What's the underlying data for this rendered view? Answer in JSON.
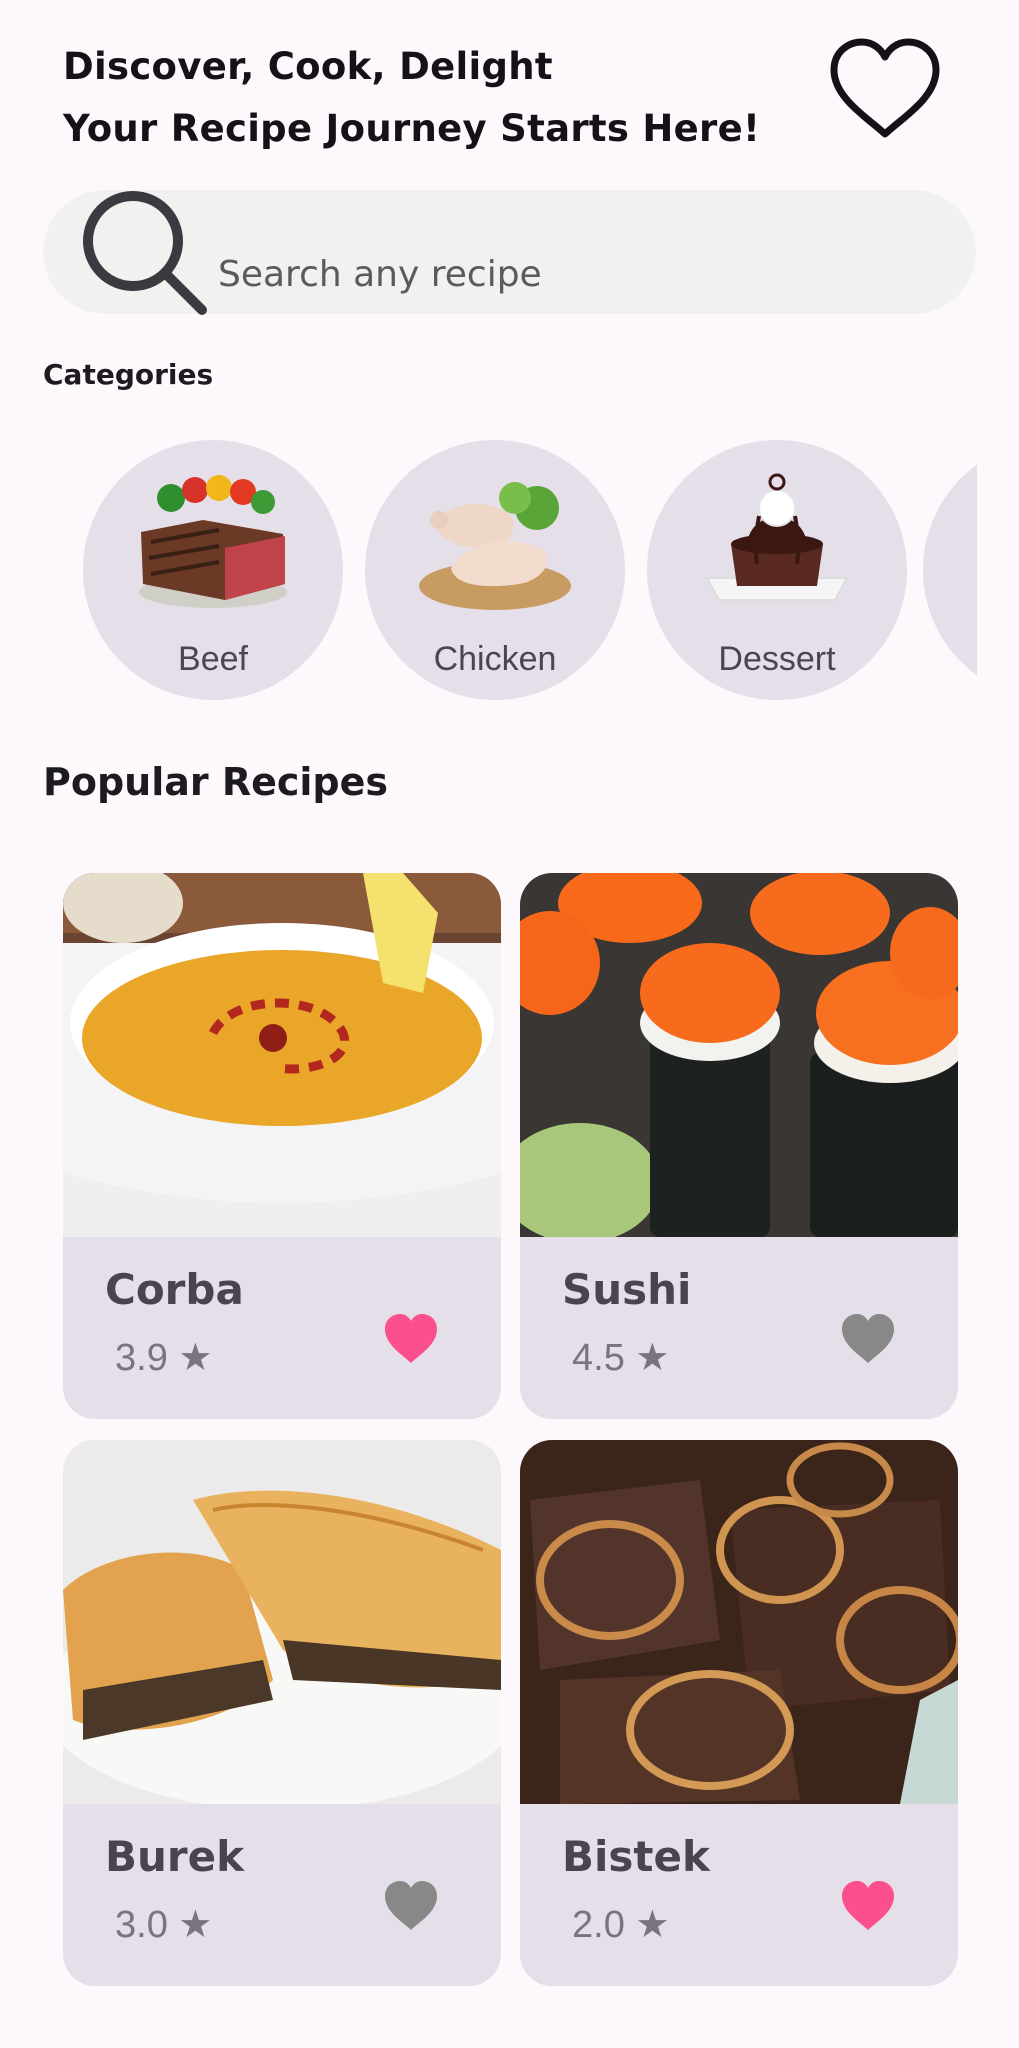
{
  "header": {
    "line1": "Discover, Cook, Delight",
    "line2": "Your Recipe Journey Starts Here!",
    "favorites_icon": "heart-outline-icon"
  },
  "search": {
    "placeholder": "Search any recipe",
    "icon": "search-icon"
  },
  "categories": {
    "title": "Categories",
    "items": [
      {
        "label": "Beef"
      },
      {
        "label": "Chicken"
      },
      {
        "label": "Dessert"
      }
    ]
  },
  "popular": {
    "title": "Popular Recipes",
    "recipes": [
      {
        "name": "Corba",
        "rating": "3.9 ★",
        "favorite": true
      },
      {
        "name": "Sushi",
        "rating": "4.5 ★",
        "favorite": false
      },
      {
        "name": "Burek",
        "rating": "3.0 ★",
        "favorite": false
      },
      {
        "name": "Bistek",
        "rating": "2.0 ★",
        "favorite": true
      }
    ]
  },
  "colors": {
    "favorite_active": "#fc4f8e",
    "favorite_inactive": "#888888",
    "card_bg": "#e5dfea",
    "search_bg": "#f1f2f0"
  }
}
